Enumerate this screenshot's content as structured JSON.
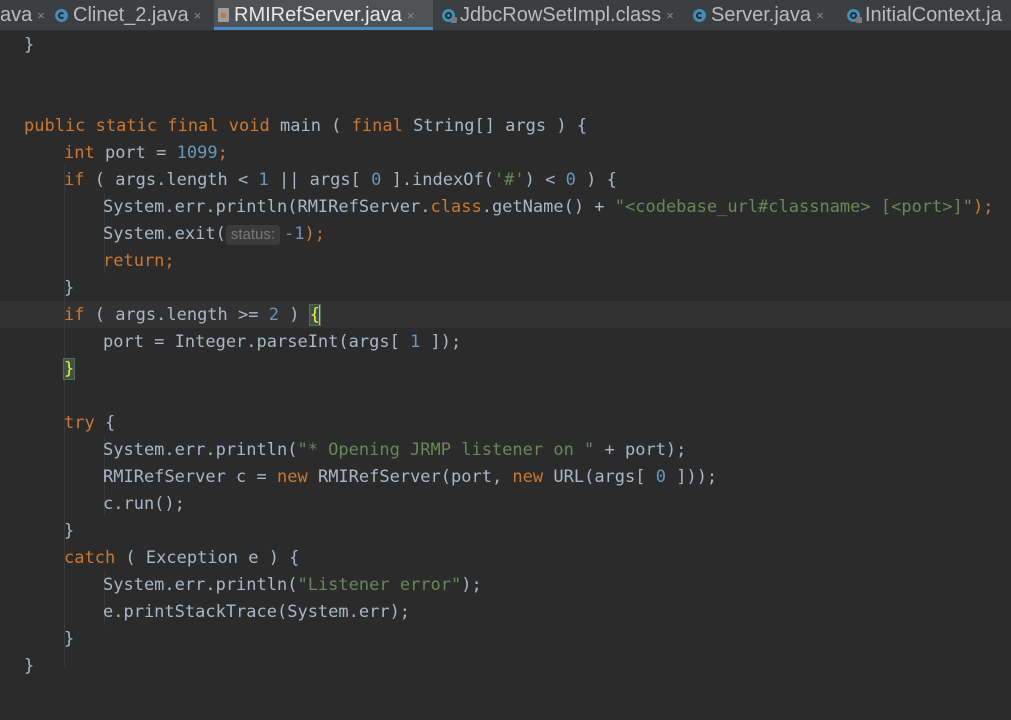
{
  "tabs": [
    {
      "label": "ava",
      "icon": "none",
      "active": false
    },
    {
      "label": "Clinet_2.java",
      "icon": "java-class-icon",
      "active": false
    },
    {
      "label": "RMIRefServer.java",
      "icon": "java-file-icon",
      "active": true
    },
    {
      "label": "JdbcRowSetImpl.class",
      "icon": "compiled-class-icon",
      "active": false
    },
    {
      "label": "Server.java",
      "icon": "java-class-icon",
      "active": false
    },
    {
      "label": "InitialContext.ja",
      "icon": "compiled-class-icon",
      "active": false
    }
  ],
  "tab_close_glyph": "×",
  "code": {
    "l1": "}",
    "l4_public": "public",
    "l4_static": "static",
    "l4_final": "final",
    "l4_void": "void",
    "l4_main": "main ( ",
    "l4_final2": "final",
    "l4_rest": " String[] args ) {",
    "l5_int": "int",
    "l5_mid": " port = ",
    "l5_num": "1099",
    "l5_end": ";",
    "l6_if": "if",
    "l6_a": " ( args.length < ",
    "l6_n1": "1",
    "l6_b": " || args[ ",
    "l6_n2": "0",
    "l6_c": " ].indexOf(",
    "l6_s": "'#'",
    "l6_d": ") < ",
    "l6_n3": "0",
    "l6_e": " ) {",
    "l7_a": "System.err.println(RMIRefServer.",
    "l7_class": "class",
    "l7_b": ".getName() + ",
    "l7_s": "\"<codebase_url#classname> [<port>]\"",
    "l7_c": ");",
    "l8_a": "System.exit(",
    "l8_hint": "status:",
    "l8_num": "-1",
    "l8_c": ");",
    "l9_return": "return",
    "l9_c": ";",
    "l10": "}",
    "l11_if": "if",
    "l11_a": " ( args.length >= ",
    "l11_n": "2",
    "l11_b": " ) ",
    "l11_brace": "{",
    "l12_a": "port = Integer.parseInt(args[ ",
    "l12_n": "1",
    "l12_b": " ]);",
    "l13_brace": "}",
    "l15_try": "try",
    "l15_b": " {",
    "l16_a": "System.err.println(",
    "l16_s": "\"* Opening JRMP listener on \"",
    "l16_b": " + port);",
    "l17_a": "RMIRefServer c = ",
    "l17_new": "new",
    "l17_b": " RMIRefServer(port, ",
    "l17_new2": "new",
    "l17_c": " URL(args[ ",
    "l17_n": "0",
    "l17_d": " ]));",
    "l18": "c.run();",
    "l19": "}",
    "l20_catch": "catch",
    "l20_b": " ( Exception e ) {",
    "l21_a": "System.err.println(",
    "l21_s": "\"Listener error\"",
    "l21_b": ");",
    "l22": "e.printStackTrace(System.err);",
    "l23": "}",
    "l24": "}"
  }
}
